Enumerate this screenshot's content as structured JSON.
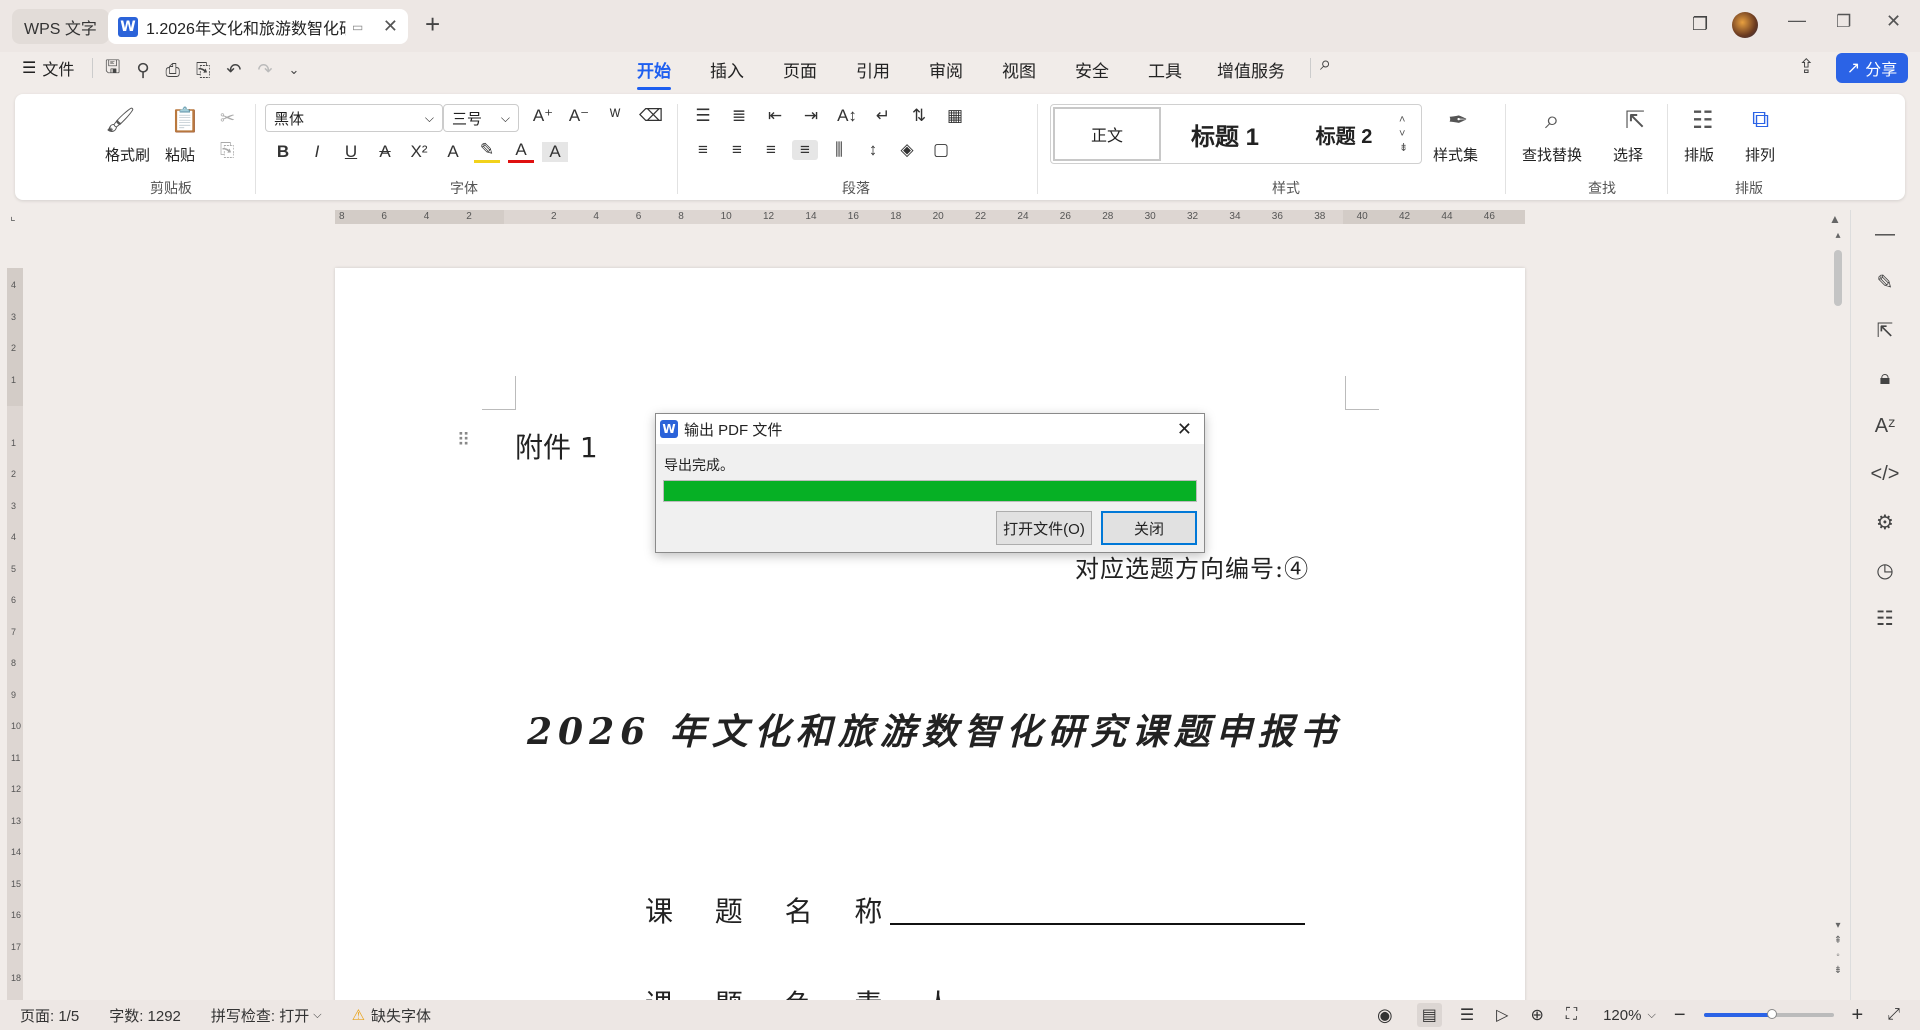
{
  "titlebar": {
    "app_tab": "WPS 文字",
    "doc_tab_title": "1.2026年文化和旅游数智化研",
    "new_tab": "+"
  },
  "menubar": {
    "file": "文件",
    "tabs": [
      "开始",
      "插入",
      "页面",
      "引用",
      "审阅",
      "视图",
      "安全",
      "工具",
      "增值服务"
    ],
    "share": "分享"
  },
  "ribbon": {
    "format_painter": "格式刷",
    "paste": "粘贴",
    "font_name": "黑体",
    "font_size": "三号",
    "styles": [
      "正文",
      "标题 1",
      "标题 2"
    ],
    "style_set": "样式集",
    "find_replace": "查找替换",
    "select": "选择",
    "layout": "排版",
    "arrange": "排列",
    "groups": {
      "clipboard": "剪贴板",
      "font": "字体",
      "paragraph": "段落",
      "styles": "样式",
      "find": "查找",
      "layout": "排版"
    }
  },
  "ruler": {
    "ticks": [
      "8",
      "6",
      "4",
      "2",
      "",
      "2",
      "4",
      "6",
      "8",
      "10",
      "12",
      "14",
      "16",
      "18",
      "20",
      "22",
      "24",
      "26",
      "28",
      "30",
      "32",
      "34",
      "36",
      "38",
      "40",
      "42",
      "44",
      "46"
    ],
    "vticks": [
      "4",
      "3",
      "2",
      "1",
      "",
      "1",
      "2",
      "3",
      "4",
      "5",
      "6",
      "7",
      "8",
      "9",
      "10",
      "11",
      "12",
      "13",
      "14",
      "15",
      "16",
      "17",
      "18"
    ]
  },
  "document": {
    "attachment": "附件 1",
    "direction": "对应选题方向编号:④",
    "title": "2026 年文化和旅游数智化研究课题申报书",
    "field1": "课  题  名  称",
    "field2": "课  题  负  责  人"
  },
  "dialog": {
    "title": "输出 PDF 文件",
    "message": "导出完成。",
    "progress": 1.0,
    "progress_color": "#06b025",
    "open_button": "打开文件(O)",
    "close_button": "关闭"
  },
  "statusbar": {
    "page": "页面: 1/5",
    "words": "字数: 1292",
    "spell": "拼写检查: 打开",
    "missing_font": "缺失字体",
    "zoom": "120%"
  },
  "colors": {
    "accent": "#1e5ff0",
    "share_bg": "#2b63e6"
  }
}
